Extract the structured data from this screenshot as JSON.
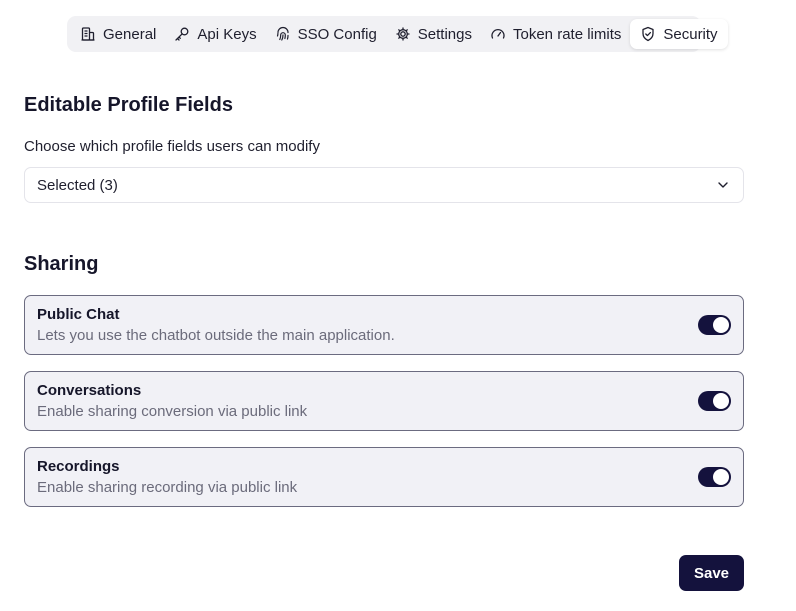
{
  "tabs": [
    {
      "label": "General",
      "icon": "building-icon",
      "active": false
    },
    {
      "label": "Api Keys",
      "icon": "key-icon",
      "active": false
    },
    {
      "label": "SSO Config",
      "icon": "fingerprint-icon",
      "active": false
    },
    {
      "label": "Settings",
      "icon": "gear-icon",
      "active": false
    },
    {
      "label": "Token rate limits",
      "icon": "gauge-icon",
      "active": false
    },
    {
      "label": "Security",
      "icon": "shield-icon",
      "active": true
    }
  ],
  "profile_fields": {
    "title": "Editable Profile Fields",
    "subtitle": "Choose which profile fields users can modify",
    "select_value": "Selected (3)"
  },
  "sharing": {
    "title": "Sharing",
    "items": [
      {
        "title": "Public Chat",
        "description": "Lets you use the chatbot outside the main application.",
        "enabled": true
      },
      {
        "title": "Conversations",
        "description": "Enable sharing conversion via public link",
        "enabled": true
      },
      {
        "title": "Recordings",
        "description": "Enable sharing recording via public link",
        "enabled": true
      }
    ]
  },
  "save_label": "Save",
  "colors": {
    "accent": "#14123d",
    "tab_bar_bg": "#f1f1f4",
    "card_bg": "#f1f1f6"
  }
}
